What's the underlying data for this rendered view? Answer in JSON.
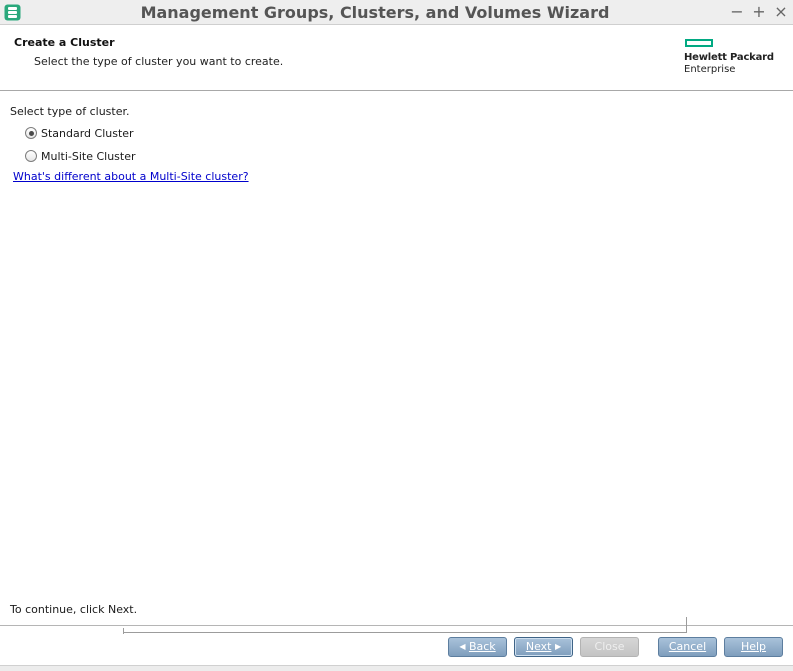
{
  "window": {
    "title": "Management Groups, Clusters, and Volumes Wizard",
    "controls": {
      "minimize": "−",
      "maximize": "+",
      "close": "×"
    },
    "app_icon": "storage-app-icon"
  },
  "header": {
    "title": "Create a Cluster",
    "subtitle": "Select the type of cluster you want to create.",
    "logo": {
      "line1": "Hewlett Packard",
      "line2": "Enterprise",
      "color": "#01a982"
    }
  },
  "content": {
    "prompt": "Select type of cluster.",
    "options": [
      {
        "label": "Standard Cluster",
        "checked": true
      },
      {
        "label": "Multi-Site Cluster",
        "checked": false
      }
    ],
    "link": "What's different about a Multi-Site cluster?"
  },
  "footer": {
    "instruction": "To continue, click Next.",
    "buttons": {
      "back": "Back",
      "next": "Next",
      "close": "Close",
      "cancel": "Cancel",
      "help": "Help"
    }
  },
  "colors": {
    "button": "#8fabc7",
    "button_disabled": "#cccccc",
    "link": "#0000cc",
    "accent": "#01a982"
  }
}
